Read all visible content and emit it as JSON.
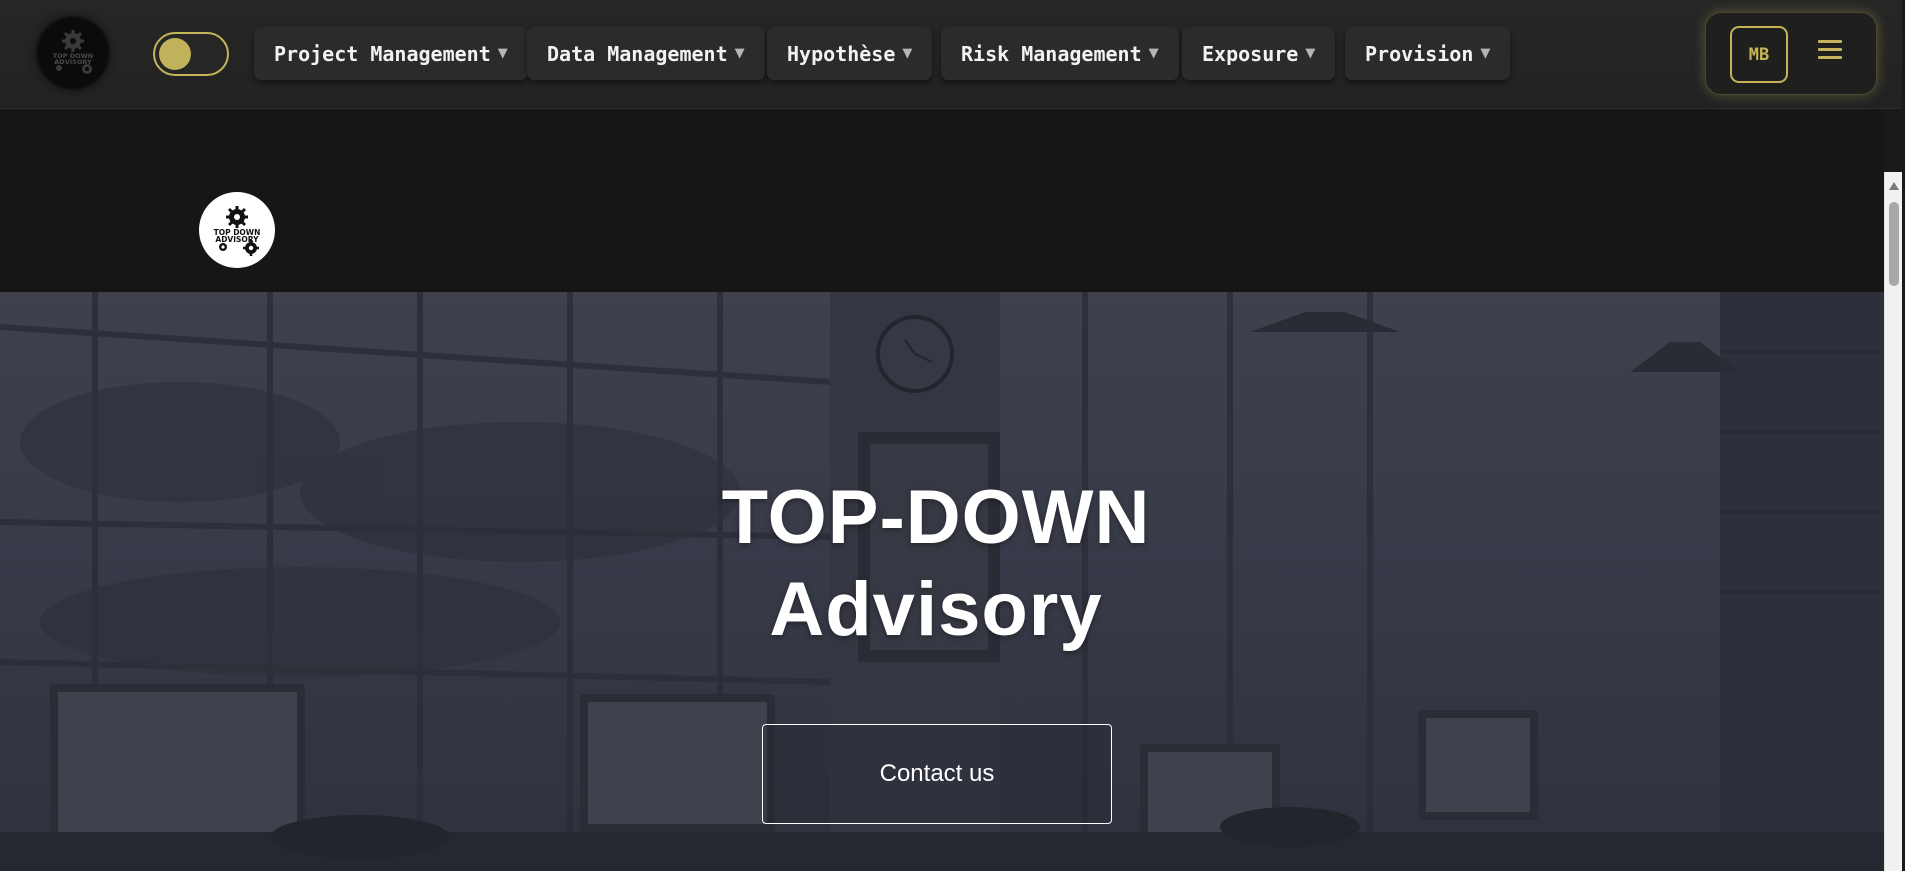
{
  "navbar": {
    "theme_toggle_state": "dark",
    "menus": [
      {
        "label": "Project Management",
        "caret": "▼"
      },
      {
        "label": "Data Management",
        "caret": "▼"
      },
      {
        "label": "Hypothèse",
        "caret": "▼"
      },
      {
        "label": "Risk Management",
        "caret": "▼"
      },
      {
        "label": "Exposure",
        "caret": "▼"
      },
      {
        "label": "Provision",
        "caret": "▼"
      }
    ],
    "user": {
      "initials": "MB"
    }
  },
  "brand": {
    "logo_text_line1": "TOP DOWN",
    "logo_text_line2": "ADVISORY",
    "icon": "gears-icon"
  },
  "hero": {
    "title_line1": "TOP-DOWN",
    "title_line2": "Advisory",
    "cta_label": "Contact us"
  },
  "colors": {
    "accent": "#c4b45a",
    "navbar_bg": "#262626",
    "menu_bg": "#2b2b2b",
    "subheader_bg": "#161616",
    "hero_overlay": "#3e4150",
    "text": "#ffffff"
  }
}
